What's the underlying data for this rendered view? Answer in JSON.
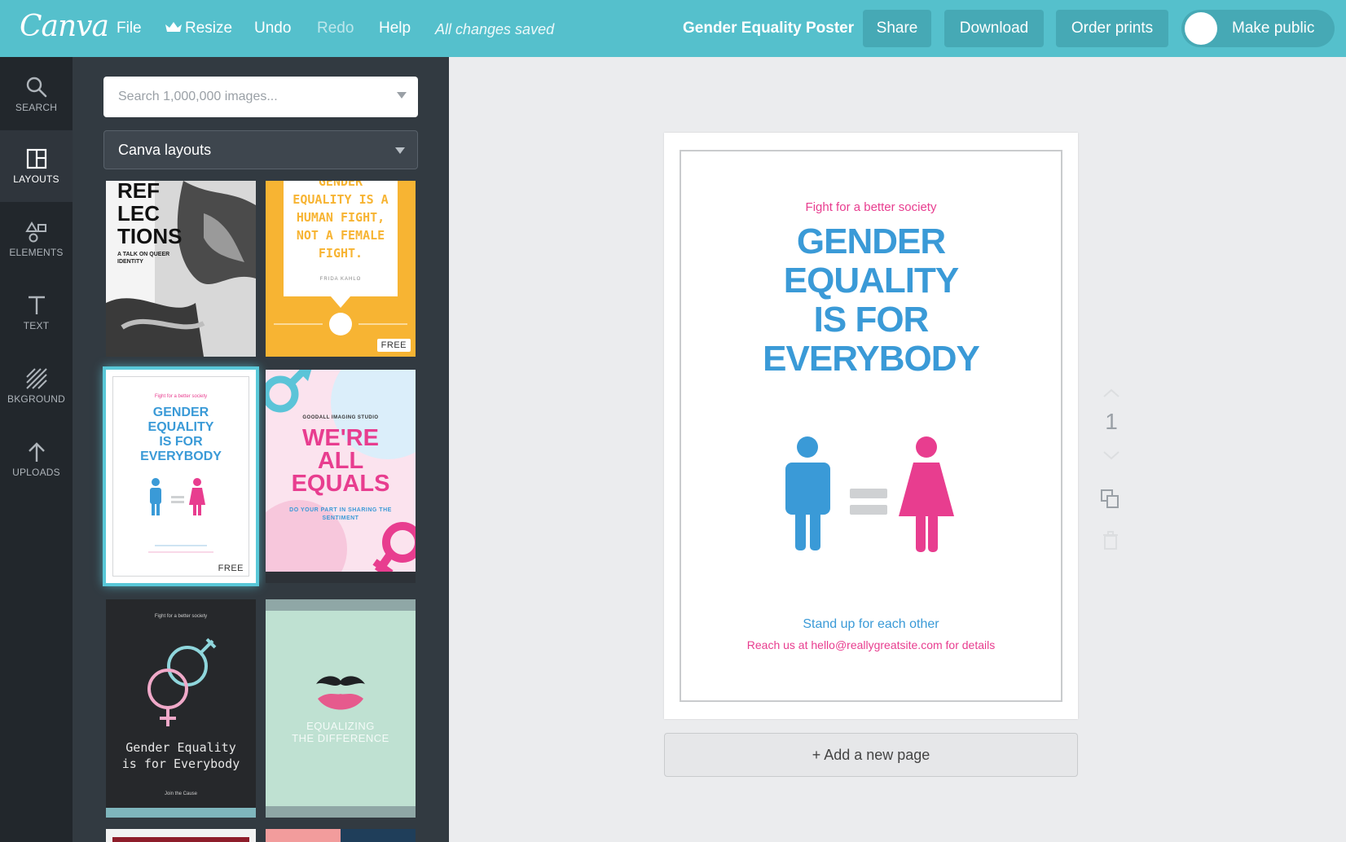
{
  "topbar": {
    "logo": "Canva",
    "menu": {
      "file": "File",
      "resize": "Resize",
      "undo": "Undo",
      "redo": "Redo",
      "help": "Help"
    },
    "status": "All changes saved",
    "design_title": "Gender Equality Poster",
    "share": "Share",
    "download": "Download",
    "order_prints": "Order prints",
    "make_public": "Make public",
    "make_public_on": false
  },
  "rail": {
    "search": "SEARCH",
    "layouts": "LAYOUTS",
    "elements": "ELEMENTS",
    "text": "TEXT",
    "background": "BKGROUND",
    "uploads": "UPLOADS"
  },
  "panel": {
    "search_placeholder": "Search 1,000,000 images...",
    "layout_filter": "Canva layouts",
    "free_label": "FREE",
    "thumbs": {
      "reflections": {
        "title_1": "REF",
        "title_2": "LEC",
        "title_3": "TIONS",
        "subtitle": "A TALK ON QUEER IDENTITY"
      },
      "human_fight": {
        "top": "GENDER",
        "line1": "EQUALITY IS A",
        "line2": "HUMAN FIGHT,",
        "line3": "NOT A FEMALE",
        "line4": "FIGHT.",
        "author": "FRIDA KAHLO"
      },
      "gender_equality": {
        "kicker": "Fight for a better society",
        "l1": "GENDER",
        "l2": "EQUALITY",
        "l3": "IS FOR",
        "l4": "EVERYBODY"
      },
      "all_equals": {
        "studio": "GOODALL IMAGING STUDIO",
        "l1": "WE'RE",
        "l2": "ALL",
        "l3": "EQUALS",
        "sub": "DO YOUR PART IN SHARING THE SENTIMENT"
      },
      "dark_poster": {
        "kicker": "Fight for a better society",
        "line1": "Gender Equality",
        "line2": "is for Everybody",
        "cta": "Join the Cause"
      },
      "mustache": {
        "line1": "EQUALIZING",
        "line2": "THE DIFFERENCE"
      }
    }
  },
  "poster": {
    "kicker": "Fight for a better society",
    "heading_1": "GENDER",
    "heading_2": "EQUALITY",
    "heading_3": "IS FOR",
    "heading_4": "EVERYBODY",
    "subline": "Stand up for each other",
    "contact": "Reach us at hello@reallygreatsite.com for details"
  },
  "canvas": {
    "add_page": "+ Add a new page",
    "page_number": "1"
  },
  "colors": {
    "topbar": "#55c0cc",
    "rail": "#22272c",
    "panel": "#323a41",
    "poster_blue": "#3a9ad7",
    "poster_pink": "#e83d8f",
    "selection": "#59c8d8"
  }
}
